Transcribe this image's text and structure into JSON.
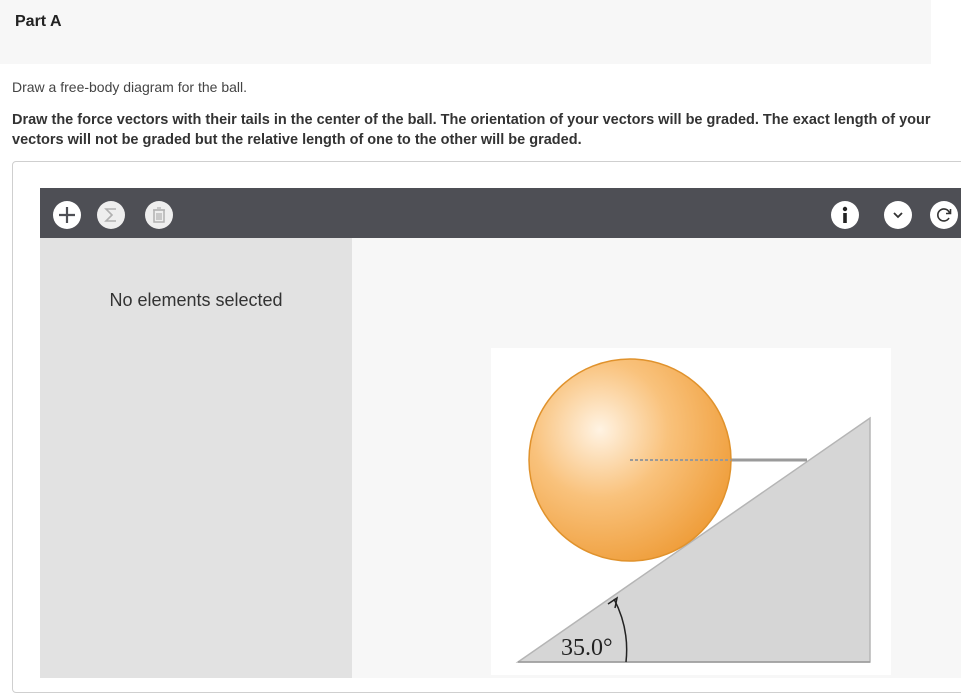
{
  "part": {
    "title": "Part A"
  },
  "question": {
    "prompt": "Draw a free-body diagram for the ball.",
    "instructions": "Draw the force vectors with their tails in the center of the ball. The orientation of your vectors will be graded. The exact length of your vectors will not be graded but the relative length of one to the other will be graded."
  },
  "toolbar": {
    "icons": [
      "add-icon",
      "sigma-icon",
      "trash-icon",
      "info-icon",
      "chevron-down-icon",
      "reset-icon"
    ]
  },
  "side_panel": {
    "empty_text": "No elements selected"
  },
  "figure": {
    "angle_label": "35.0°"
  },
  "colors": {
    "toolbar": "#4e4f55",
    "panel": "#e2e2e2",
    "ball": "#f5a94a",
    "incline": "#d6d6d6"
  }
}
